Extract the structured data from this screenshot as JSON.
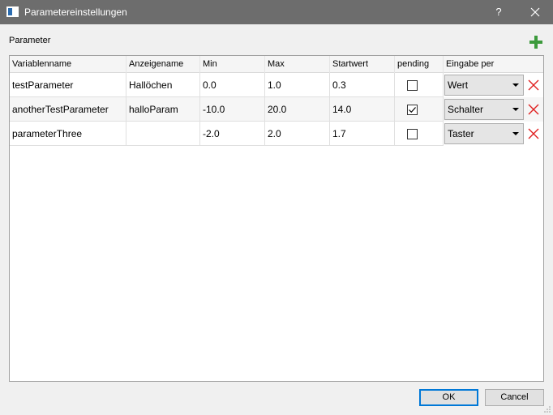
{
  "window": {
    "title": "Parametereinstellungen",
    "help_label": "?"
  },
  "section": {
    "label": "Parameter"
  },
  "table": {
    "columns": [
      "Variablenname",
      "Anzeigename",
      "Min",
      "Max",
      "Startwert",
      "pending",
      "Eingabe per"
    ],
    "rows": [
      {
        "variablenname": "testParameter",
        "anzeigename": "Hallöchen",
        "min": "0.0",
        "max": "1.0",
        "startwert": "0.3",
        "pending": false,
        "eingabe": "Wert"
      },
      {
        "variablenname": "anotherTestParameter",
        "anzeigename": "halloParam",
        "min": "-10.0",
        "max": "20.0",
        "startwert": "14.0",
        "pending": true,
        "eingabe": "Schalter"
      },
      {
        "variablenname": "parameterThree",
        "anzeigename": "",
        "min": "-2.0",
        "max": "2.0",
        "startwert": "1.7",
        "pending": false,
        "eingabe": "Taster"
      }
    ]
  },
  "buttons": {
    "ok": "OK",
    "cancel": "Cancel"
  },
  "icons": {
    "add": "plus-icon",
    "delete": "x-icon",
    "close": "close-icon"
  },
  "colors": {
    "titlebar": "#6d6d6d",
    "add_green": "#3c9a3c",
    "delete_red": "#e02020",
    "default_button_border": "#0078d7"
  }
}
